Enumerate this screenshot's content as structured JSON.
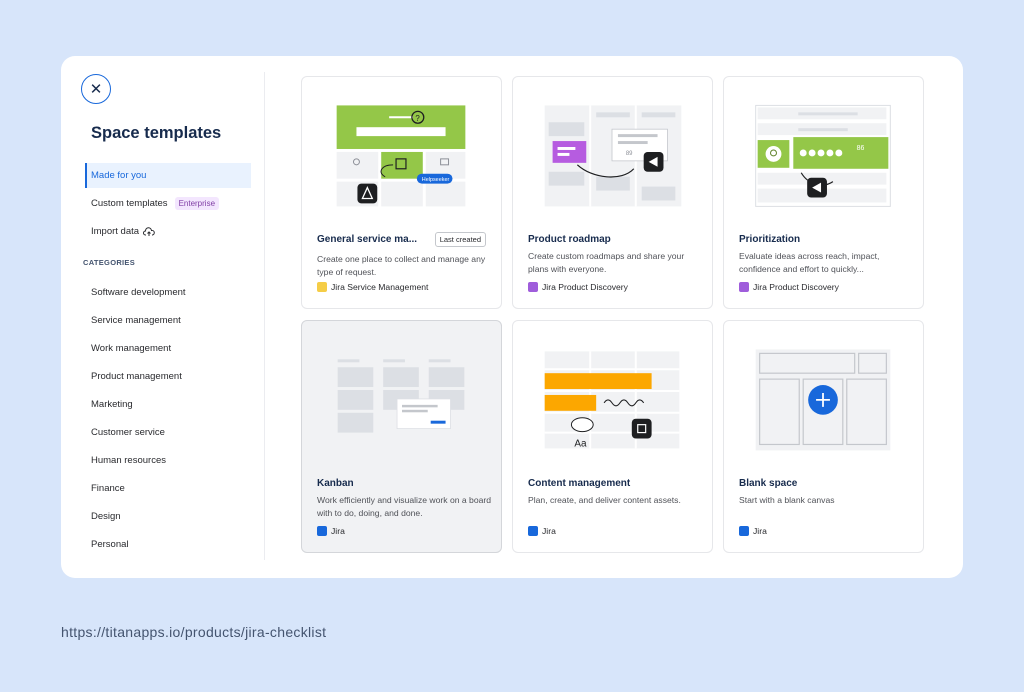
{
  "dialog": {
    "close_icon": "close-icon",
    "title": "Space templates",
    "nav": [
      {
        "label": "Made for you",
        "selected": true
      },
      {
        "label": "Custom templates",
        "badge": "Enterprise"
      },
      {
        "label": "Import data",
        "icon": "cloud-upload-icon"
      }
    ],
    "categories_heading": "CATEGORIES",
    "categories": [
      "Software development",
      "Service management",
      "Work management",
      "Product management",
      "Marketing",
      "Customer service",
      "Human resources",
      "Finance",
      "Design",
      "Personal"
    ]
  },
  "cards": [
    {
      "title": "General service ma...",
      "tag": "Last created",
      "desc": "Create one place to collect and manage any type of request.",
      "product": "Jira Service Management",
      "product_color": "#f5cd47",
      "illus_label": "Helpseeker"
    },
    {
      "title": "Product roadmap",
      "desc": "Create custom roadmaps and share your plans with everyone.",
      "product": "Jira Product Discovery",
      "product_color": "#9f5ddb",
      "illus_label": "89"
    },
    {
      "title": "Prioritization",
      "desc": "Evaluate ideas across reach, impact, confidence and effort to quickly...",
      "product": "Jira Product Discovery",
      "product_color": "#9f5ddb",
      "illus_label": "86"
    },
    {
      "title": "Kanban",
      "desc": "Work efficiently and visualize work on a board with to do, doing, and done.",
      "product": "Jira",
      "product_color": "#1868db"
    },
    {
      "title": "Content management",
      "desc": "Plan, create, and deliver content assets.",
      "product": "Jira",
      "product_color": "#1868db",
      "illus_label": "Aa"
    },
    {
      "title": "Blank space",
      "desc": "Start with a blank canvas",
      "product": "Jira",
      "product_color": "#1868db"
    }
  ],
  "footer": {
    "url": "https://titanapps.io/products/jira-checklist"
  },
  "colors": {
    "accent": "#1868db",
    "green": "#94c748",
    "orange": "#fca700",
    "purple": "#9f5ddb"
  }
}
